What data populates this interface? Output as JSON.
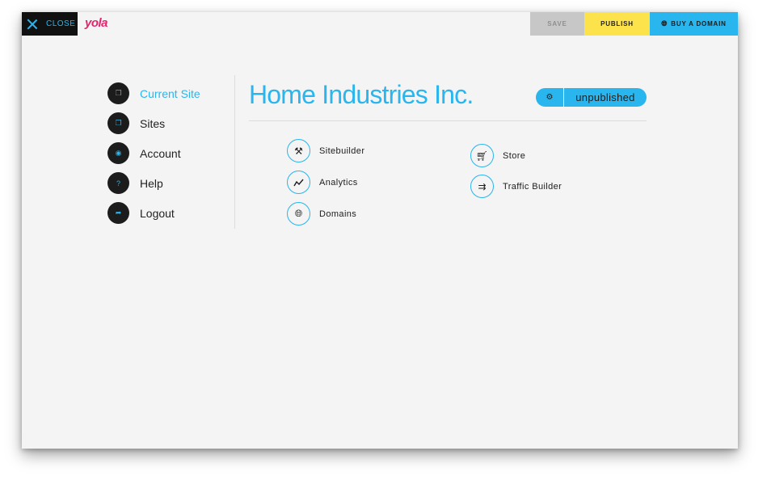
{
  "topbar": {
    "close_label": "CLOSE",
    "logo": "yola",
    "save_label": "SAVE",
    "publish_label": "PUBLISH",
    "buy_domain_label": "BUY A DOMAIN"
  },
  "sidebar": {
    "items": [
      {
        "label": "Current Site",
        "icon": "window-icon",
        "active": true
      },
      {
        "label": "Sites",
        "icon": "windows-icon",
        "active": false
      },
      {
        "label": "Account",
        "icon": "eye-icon",
        "active": false
      },
      {
        "label": "Help",
        "icon": "question-icon",
        "active": false
      },
      {
        "label": "Logout",
        "icon": "logout-icon",
        "active": false
      }
    ]
  },
  "site": {
    "title": "Home Industries Inc.",
    "status": "unpublished"
  },
  "tools": [
    {
      "label": "Sitebuilder",
      "icon": "tools-icon"
    },
    {
      "label": "Analytics",
      "icon": "chart-line-icon"
    },
    {
      "label": "Domains",
      "icon": "globe-icon"
    },
    {
      "label": "Store",
      "icon": "cart-icon"
    },
    {
      "label": "Traffic Builder",
      "icon": "arrows-icon"
    }
  ],
  "colors": {
    "accent": "#29b6ee",
    "publish": "#fde34b",
    "save": "#c7c7c7",
    "logo": "#e5246b",
    "dark": "#1c1c1c"
  }
}
